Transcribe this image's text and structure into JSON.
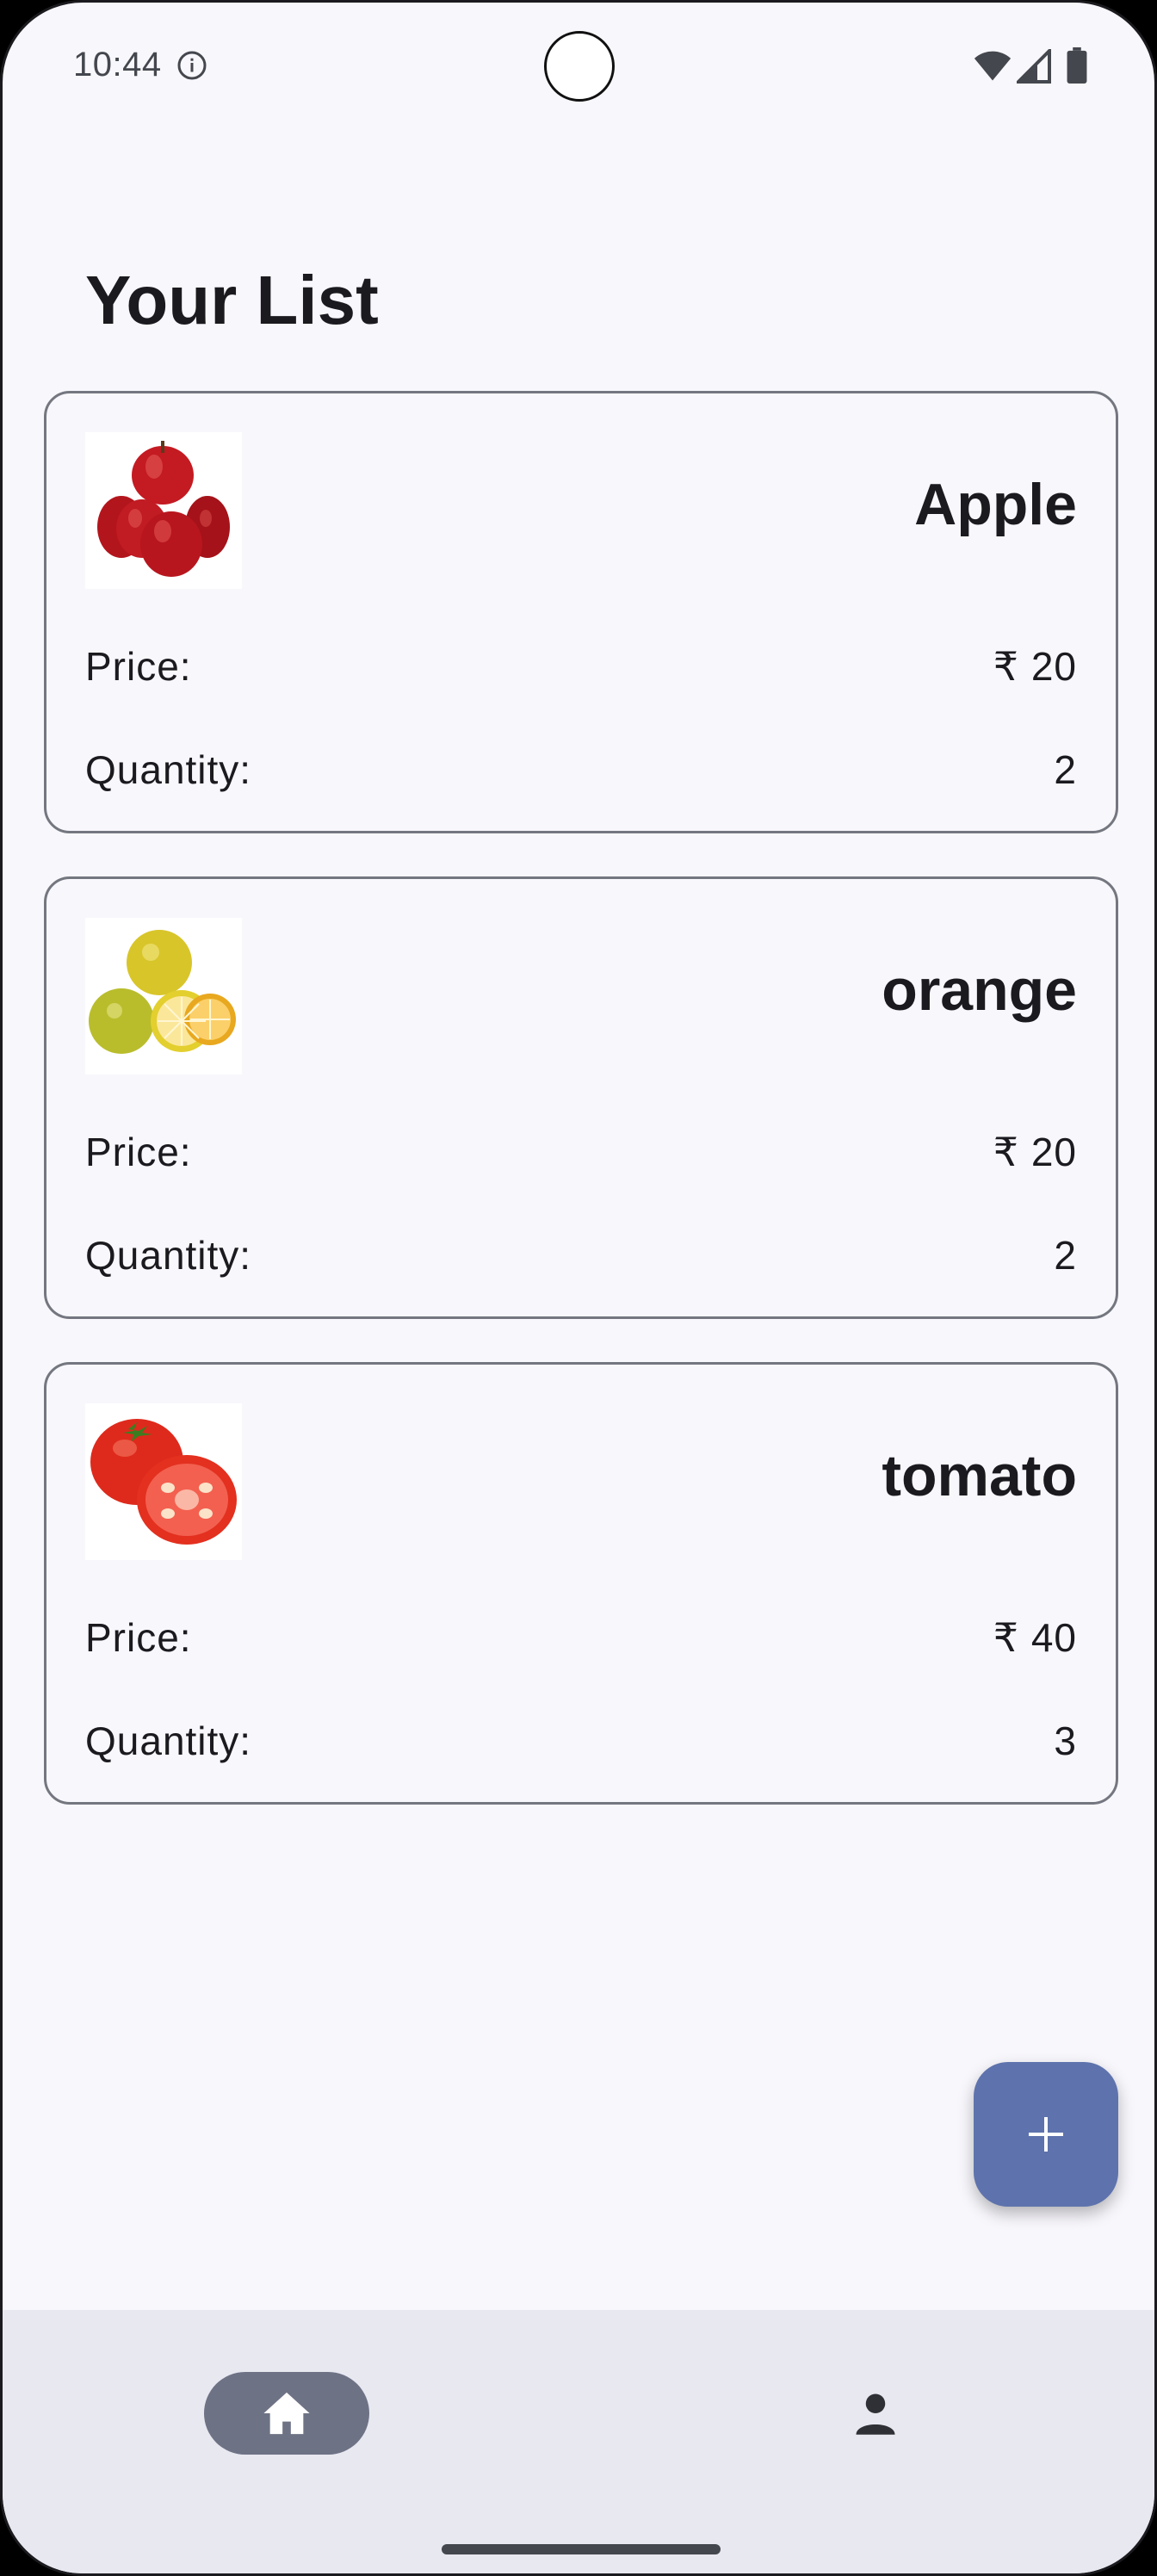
{
  "status_bar": {
    "time": "10:44",
    "icons": [
      "info-icon",
      "wifi-icon",
      "signal-icon",
      "battery-icon"
    ]
  },
  "page": {
    "title": "Your List"
  },
  "items": [
    {
      "name": "Apple",
      "image_icon": "apple-image",
      "price_label": "Price:",
      "price_value": "₹ 20",
      "quantity_label": "Quantity:",
      "quantity_value": "2"
    },
    {
      "name": "orange",
      "image_icon": "orange-image",
      "price_label": "Price:",
      "price_value": "₹ 20",
      "quantity_label": "Quantity:",
      "quantity_value": "2"
    },
    {
      "name": "tomato",
      "image_icon": "tomato-image",
      "price_label": "Price:",
      "price_value": "₹ 40",
      "quantity_label": "Quantity:",
      "quantity_value": "3"
    }
  ],
  "fab": {
    "icon": "plus-icon"
  },
  "bottom_nav": {
    "items": [
      {
        "icon": "home-icon",
        "selected": true
      },
      {
        "icon": "person-icon",
        "selected": false
      }
    ]
  },
  "colors": {
    "background": "#f8f7fc",
    "card_border": "#74777f",
    "fab": "#5e73ad",
    "nav_background": "#e8e8f1",
    "nav_selected": "#6e7285",
    "text": "#1b1b1f"
  }
}
